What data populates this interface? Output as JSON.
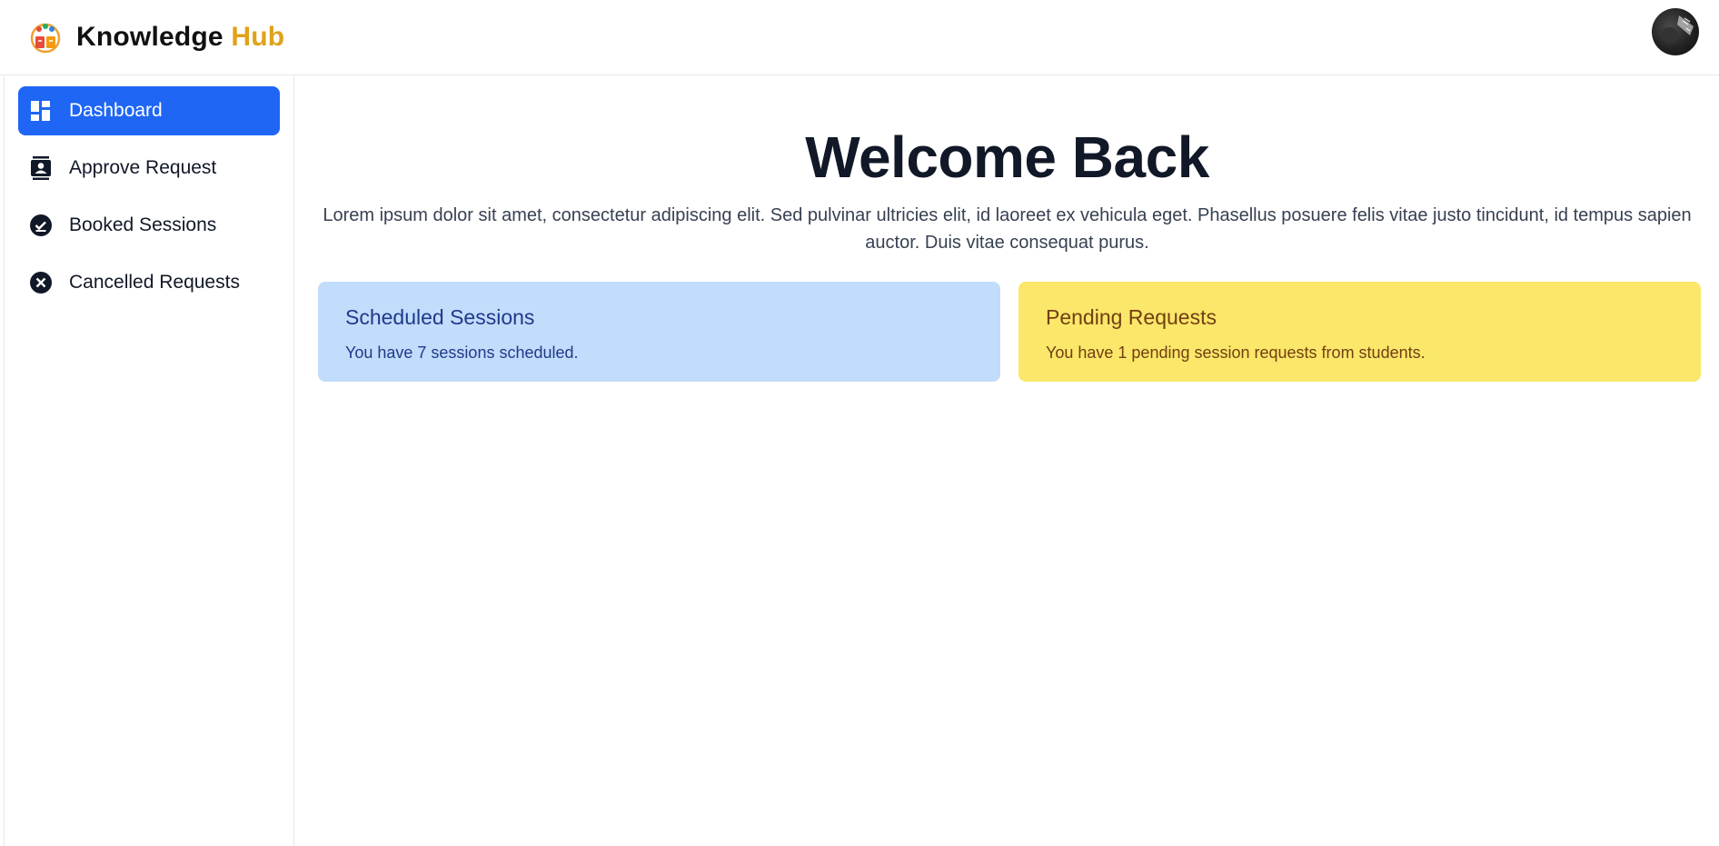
{
  "header": {
    "brand_primary": "Knowledge",
    "brand_accent": "Hub",
    "logo_icon": "knowledge-hub-logo",
    "avatar_icon": "user-avatar",
    "accent_color": "#e0a21a"
  },
  "sidebar": {
    "items": [
      {
        "label": "Dashboard",
        "icon": "dashboard-icon",
        "active": true
      },
      {
        "label": "Approve Request",
        "icon": "contact-badge-icon",
        "active": false
      },
      {
        "label": "Booked Sessions",
        "icon": "check-circle-icon",
        "active": false
      },
      {
        "label": "Cancelled Requests",
        "icon": "x-circle-icon",
        "active": false
      }
    ],
    "active_color": "#1f66f5"
  },
  "main": {
    "title": "Welcome Back",
    "intro": "Lorem ipsum dolor sit amet, consectetur adipiscing elit. Sed pulvinar ultricies elit, id laoreet ex vehicula eget. Phasellus posuere felis vitae justo tincidunt, id tempus sapien auctor. Duis vitae consequat purus.",
    "cards": [
      {
        "title": "Scheduled Sessions",
        "text": "You have 7 sessions scheduled.",
        "color": "#c2dcfb"
      },
      {
        "title": "Pending Requests",
        "text": "You have 1 pending session requests from students.",
        "color": "#fbe76a"
      }
    ]
  }
}
